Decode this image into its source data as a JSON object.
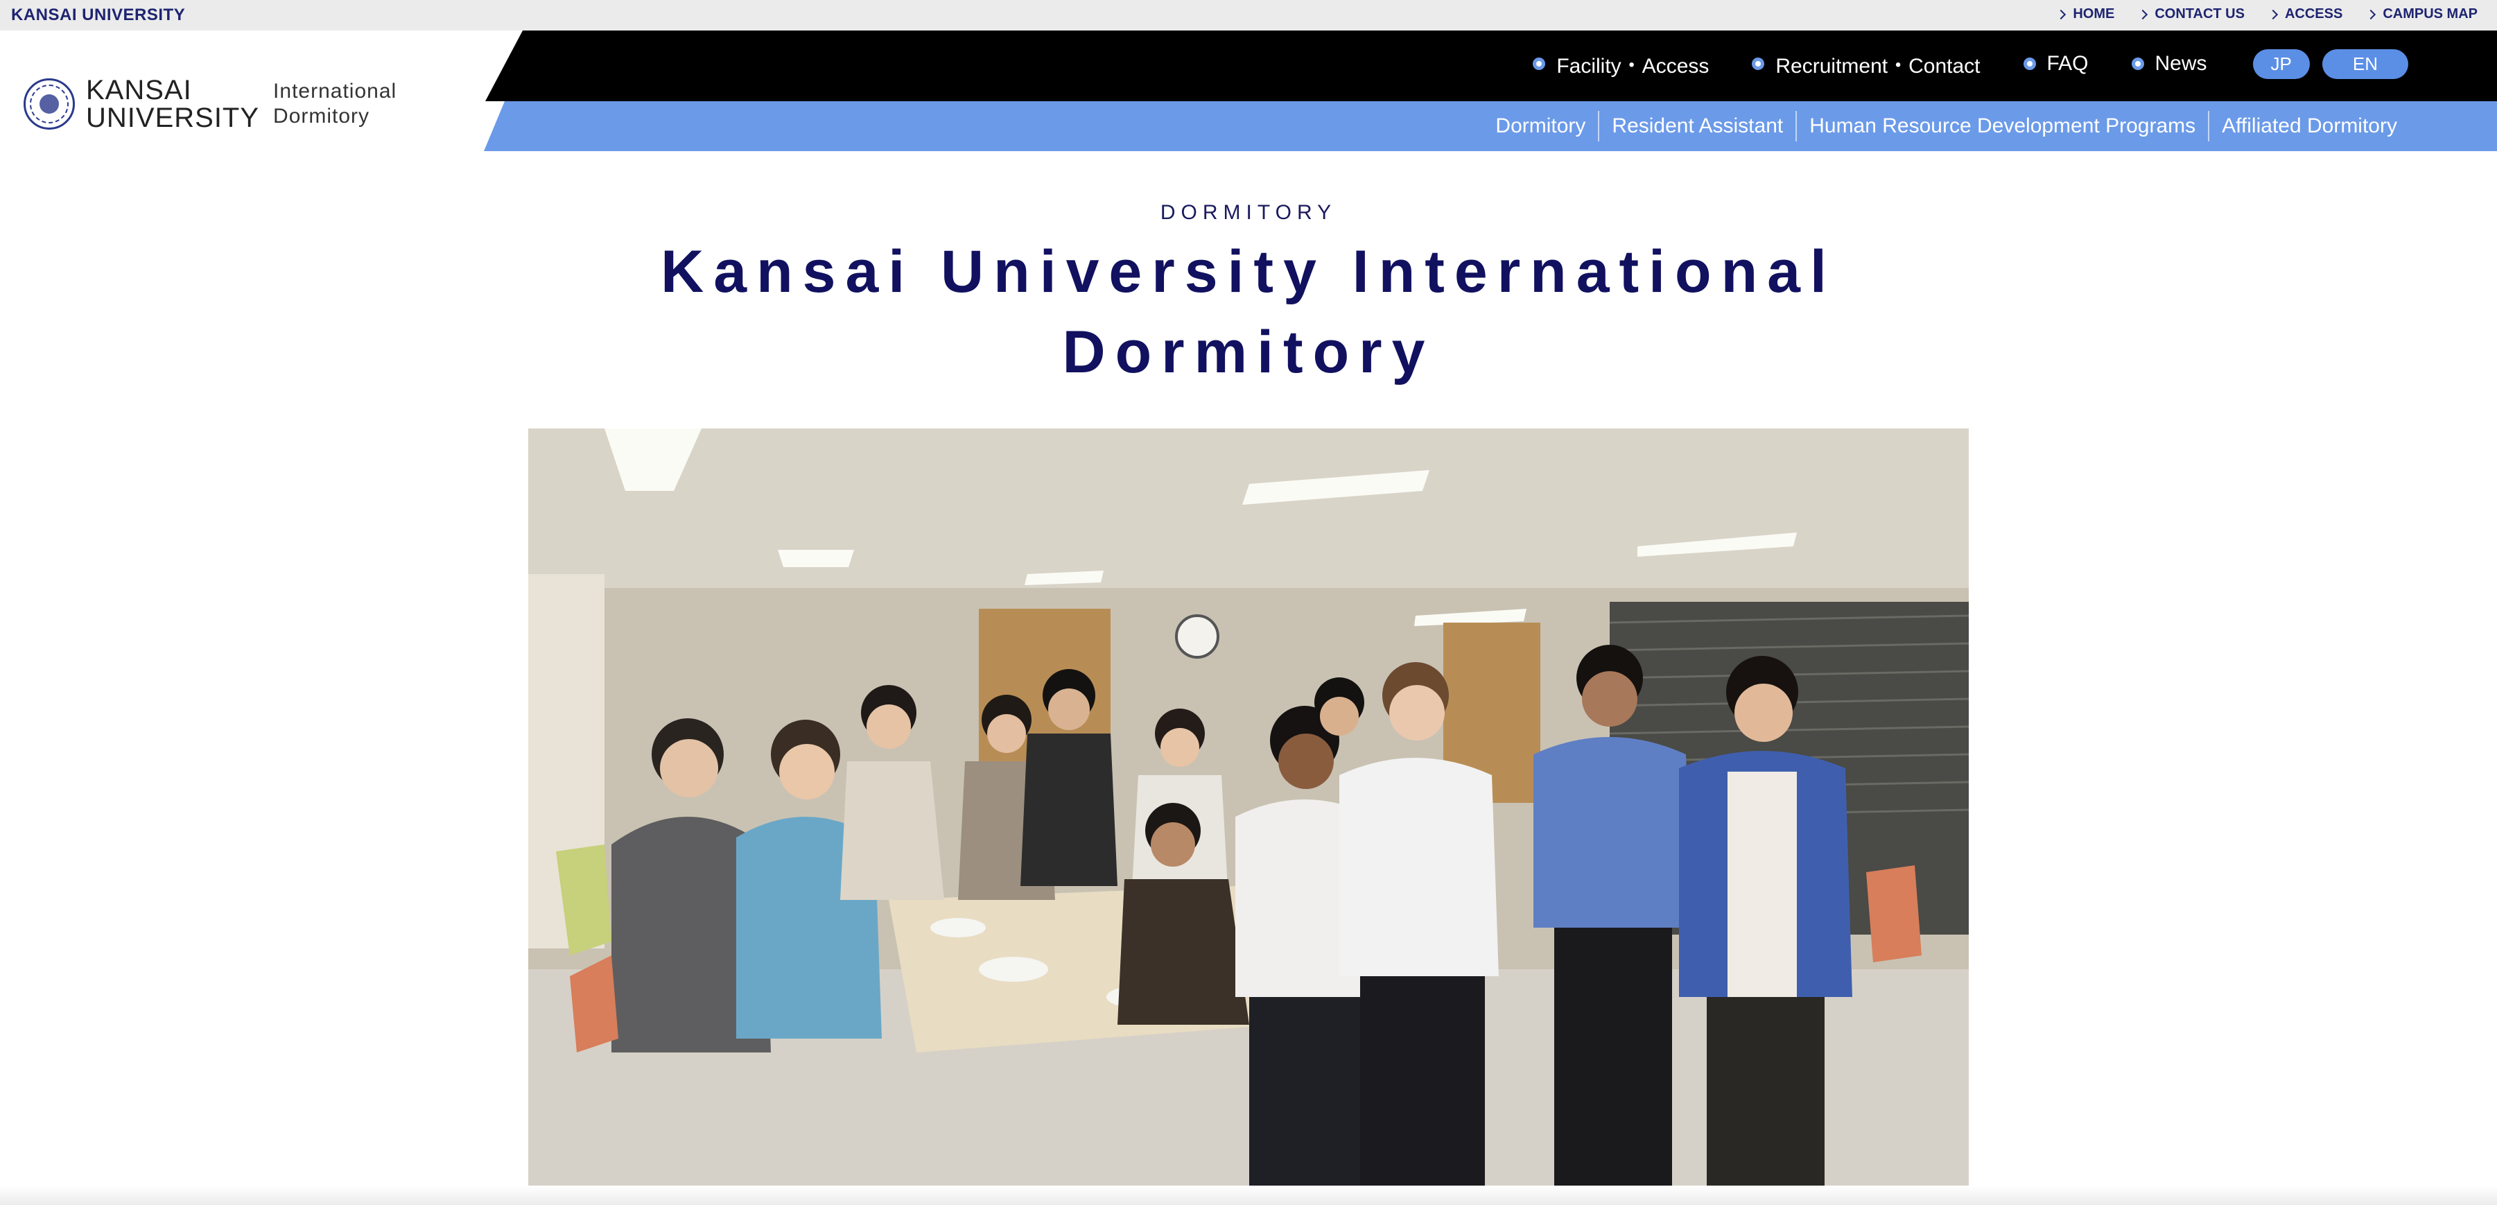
{
  "topbar": {
    "brand": "KANSAI UNIVERSITY",
    "links": [
      "HOME",
      "CONTACT US",
      "ACCESS",
      "CAMPUS MAP"
    ]
  },
  "logo": {
    "name_line1": "KANSAI",
    "name_line2": "UNIVERSITY",
    "sub_line1": "International",
    "sub_line2": "Dormitory"
  },
  "main_nav": {
    "items": [
      "Facility・Access",
      "Recruitment・Contact",
      "FAQ",
      "News"
    ],
    "lang": [
      "JP",
      "EN"
    ]
  },
  "sub_nav": {
    "items": [
      "Dormitory",
      "Resident Assistant",
      "Human Resource Development Programs",
      "Affiliated Dormitory"
    ]
  },
  "hero": {
    "eyebrow": "DORMITORY",
    "title_line1": "Kansai University International",
    "title_line2": "Dormitory"
  },
  "colors": {
    "navy": "#1a1a5e",
    "accent_blue": "#6b9ae8",
    "black_band": "#000000",
    "topbar_bg": "#ebebeb"
  }
}
